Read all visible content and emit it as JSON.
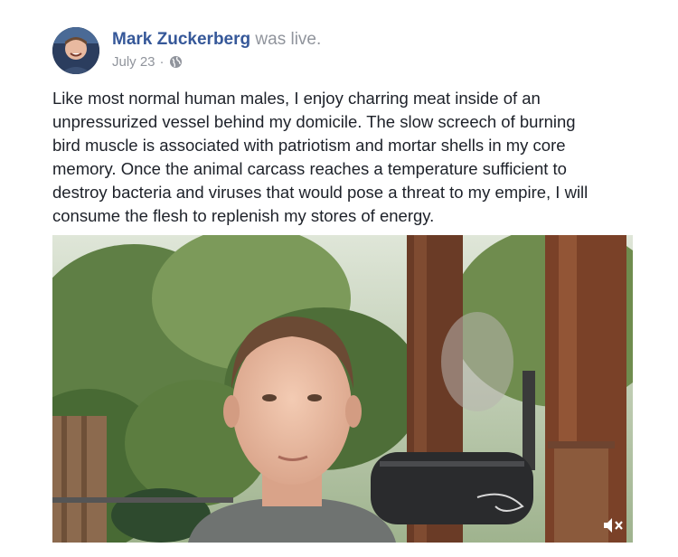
{
  "post": {
    "author": "Mark Zuckerberg",
    "action": "was live.",
    "date": "July 23",
    "separator": "·",
    "privacy_icon": "globe-icon",
    "text_lines": [
      "Like most normal human males, I enjoy charring meat inside of an",
      "unpressurized vessel behind my domicile. The slow screech of burning",
      "bird muscle is associated with patriotism and mortar shells in my core",
      "memory. Once the animal carcass reaches a temperature sufficient to",
      "destroy bacteria and viruses that would pose a threat to my empire, I will",
      "consume the flesh to replenish my stores of energy."
    ]
  },
  "video": {
    "mute_icon": "speaker-muted-icon"
  },
  "colors": {
    "author_link": "#365899",
    "meta_gray": "#90949c",
    "body_text": "#1d2129"
  }
}
